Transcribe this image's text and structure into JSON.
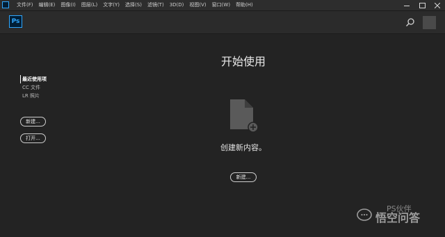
{
  "menubar": {
    "items": [
      "文件(F)",
      "编辑(E)",
      "图像(I)",
      "图层(L)",
      "文字(Y)",
      "选择(S)",
      "滤镜(T)",
      "3D(D)",
      "视图(V)",
      "窗口(W)",
      "帮助(H)"
    ]
  },
  "toolbar": {
    "logo_text": "Ps"
  },
  "sidebar": {
    "links": [
      "最近使用项",
      "CC 文件",
      "LR 照片"
    ],
    "new_label": "新建...",
    "open_label": "打开..."
  },
  "main": {
    "heading": "开始使用",
    "subtext": "创建新内容。",
    "new_label": "新建..."
  },
  "watermark": {
    "text": "悟空问答",
    "top_text": "PS伙伴"
  },
  "colors": {
    "background": "#232323",
    "toolbar": "#2b2b2b",
    "menubar": "#2d2d2d",
    "ps_accent": "#31a8ff"
  }
}
